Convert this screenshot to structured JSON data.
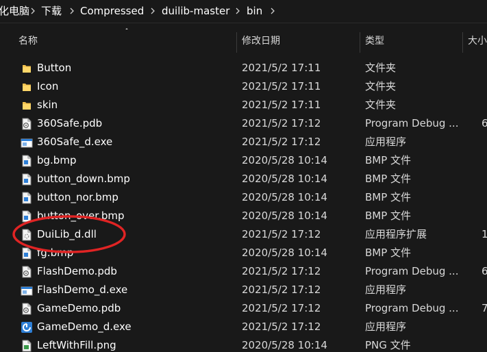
{
  "breadcrumb": {
    "items": [
      "化电脑",
      "下载",
      "Compressed",
      "duilib-master",
      "bin"
    ]
  },
  "columns": {
    "name": "名称",
    "date": "修改日期",
    "type": "类型",
    "size": "大小"
  },
  "files": [
    {
      "name": "Button",
      "date": "2021/5/2 17:11",
      "type": "文件夹",
      "size": "",
      "icon": "folder-icon"
    },
    {
      "name": "Icon",
      "date": "2021/5/2 17:11",
      "type": "文件夹",
      "size": "",
      "icon": "folder-icon"
    },
    {
      "name": "skin",
      "date": "2021/5/2 17:11",
      "type": "文件夹",
      "size": "",
      "icon": "folder-icon"
    },
    {
      "name": "360Safe.pdb",
      "date": "2021/5/2 17:12",
      "type": "Program Debug ...",
      "size": "6",
      "icon": "pdb-file-icon"
    },
    {
      "name": "360Safe_d.exe",
      "date": "2021/5/2 17:12",
      "type": "应用程序",
      "size": "",
      "icon": "exe-file-icon"
    },
    {
      "name": "bg.bmp",
      "date": "2020/5/28 10:14",
      "type": "BMP 文件",
      "size": "",
      "icon": "bmp-file-icon"
    },
    {
      "name": "button_down.bmp",
      "date": "2020/5/28 10:14",
      "type": "BMP 文件",
      "size": "",
      "icon": "bmp-file-icon"
    },
    {
      "name": "button_nor.bmp",
      "date": "2020/5/28 10:14",
      "type": "BMP 文件",
      "size": "",
      "icon": "bmp-file-icon"
    },
    {
      "name": "button_over.bmp",
      "date": "2020/5/28 10:14",
      "type": "BMP 文件",
      "size": "",
      "icon": "bmp-file-icon"
    },
    {
      "name": "DuiLib_d.dll",
      "date": "2021/5/2 17:12",
      "type": "应用程序扩展",
      "size": "1",
      "icon": "dll-file-icon"
    },
    {
      "name": "fg.bmp",
      "date": "2020/5/28 10:14",
      "type": "BMP 文件",
      "size": "",
      "icon": "bmp-file-icon"
    },
    {
      "name": "FlashDemo.pdb",
      "date": "2021/5/2 17:12",
      "type": "Program Debug ...",
      "size": "6",
      "icon": "pdb-file-icon"
    },
    {
      "name": "FlashDemo_d.exe",
      "date": "2021/5/2 17:12",
      "type": "应用程序",
      "size": "",
      "icon": "exe-file-icon"
    },
    {
      "name": "GameDemo.pdb",
      "date": "2021/5/2 17:12",
      "type": "Program Debug ...",
      "size": "7",
      "icon": "pdb-file-icon"
    },
    {
      "name": "GameDemo_d.exe",
      "date": "2021/5/2 17:12",
      "type": "应用程序",
      "size": "",
      "icon": "game-exe-icon"
    },
    {
      "name": "LeftWithFill.png",
      "date": "2020/5/28 10:14",
      "type": "PNG 文件",
      "size": "",
      "icon": "png-file-icon"
    }
  ],
  "colors": {
    "background": "#191919",
    "text": "#ffffff",
    "folder": "#f2c14e",
    "annotation": "#e02424"
  }
}
